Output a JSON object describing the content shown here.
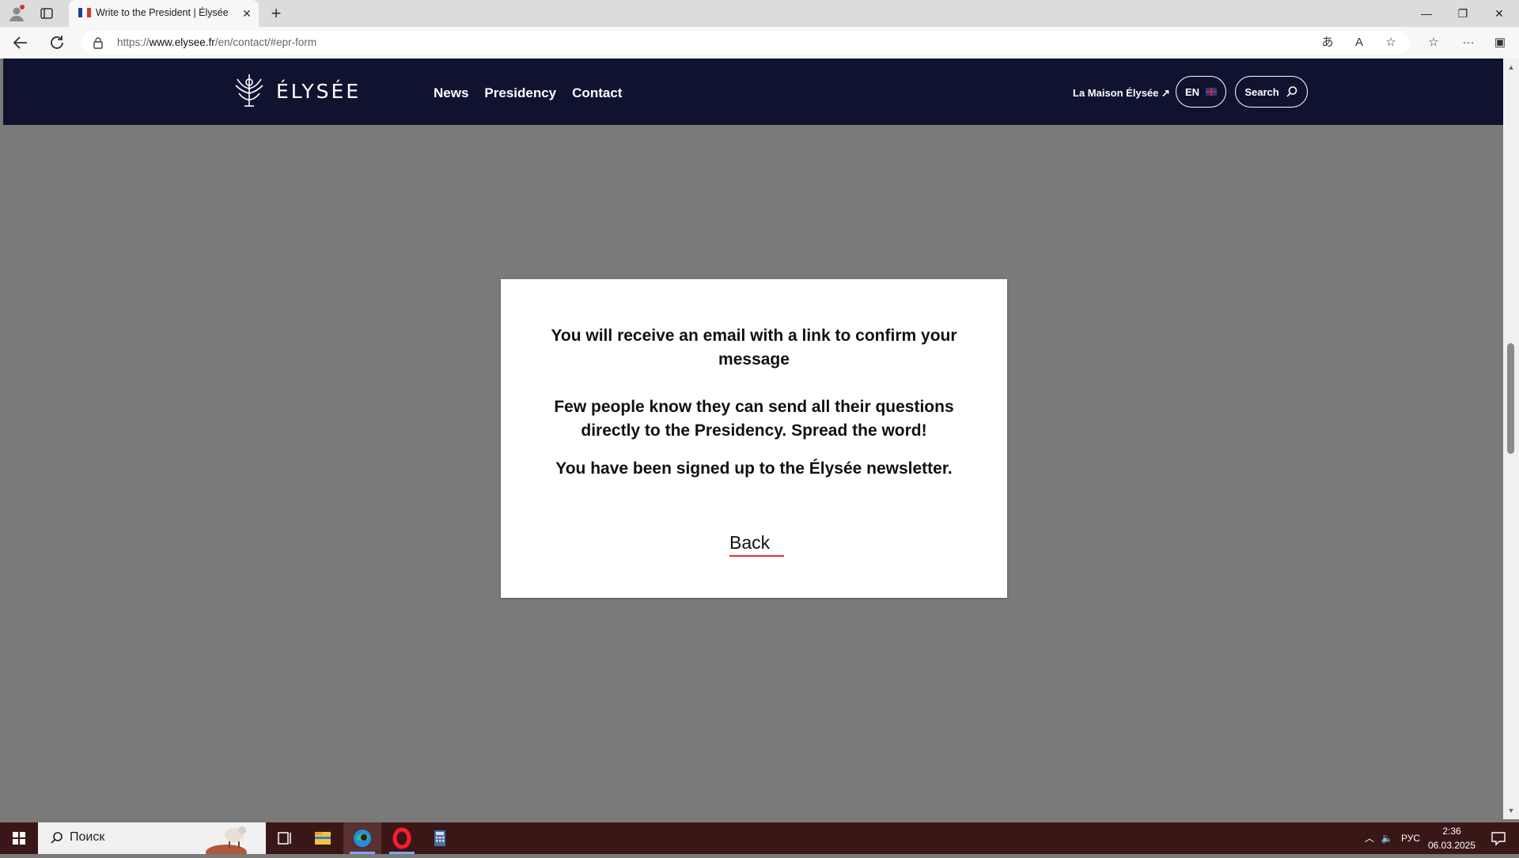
{
  "browser": {
    "tab_title": "Write to the President | Élysée",
    "url_prefix": "https://",
    "url_host": "www.elysee.fr",
    "url_path": "/en/contact/#epr-form"
  },
  "header": {
    "logo_text": "ÉLYSÉE",
    "nav": [
      "News",
      "Presidency",
      "Contact"
    ],
    "maison_link": "La Maison Élysée ↗",
    "lang": "EN",
    "search_label": "Search"
  },
  "modal": {
    "line1": "You will receive an email with a link to confirm your message",
    "line2": "Few people know they can send all their questions directly to the Presidency. Spread the word!",
    "line3": "You have been signed up to the Élysée newsletter.",
    "back_label": "Back"
  },
  "taskbar": {
    "search_placeholder": "Поиск",
    "lang": "РУС",
    "time": "2:36",
    "date": "06.03.2025"
  },
  "colors": {
    "header_bg": "#0f1330",
    "overlay": "#7a7a7a",
    "accent_underline": "#e0322d",
    "taskbar": "#3a1717"
  }
}
